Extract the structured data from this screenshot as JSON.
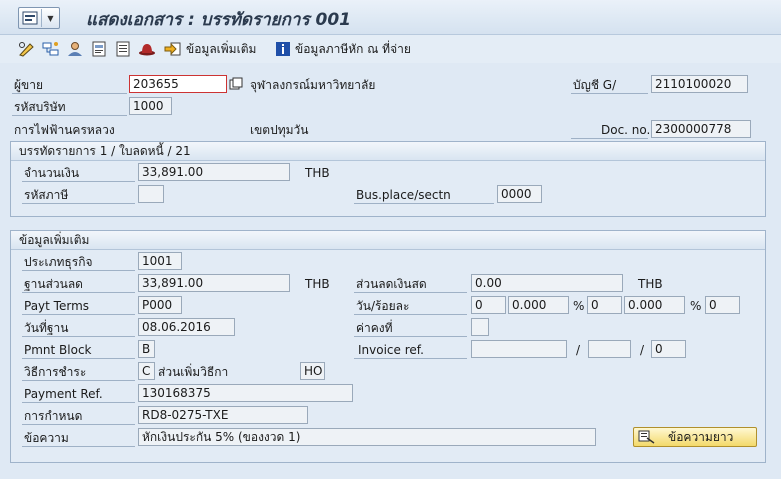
{
  "window": {
    "title": "แสดงเอกสาร : บรรทัดรายการ 001"
  },
  "toolbar": {
    "additional_data_label": "ข้อมูลเพิ่มเติม",
    "withholding_tax_label": "ข้อมูลภาษีหัก ณ ที่จ่าย"
  },
  "header": {
    "vendor_label": "ผู้ขาย",
    "vendor_value": "203655",
    "vendor_name": "จุฬาลงกรณ์มหาวิทยาลัย",
    "gl_account_label": "บัญชี G/",
    "gl_account_value": "2110100020",
    "company_code_label": "รหัสบริษัท",
    "company_code_value": "1000",
    "company_name": "การไฟฟ้านครหลวง",
    "city": "เขตปทุมวัน",
    "doc_no_label": "Doc. no.",
    "doc_no_value": "2300000778"
  },
  "line_item": {
    "title": "บรรทัดรายการ 1 / ใบลดหนี้ / 21",
    "amount_label": "จำนวนเงิน",
    "amount_value": "33,891.00",
    "currency": "THB",
    "tax_code_label": "รหัสภาษี",
    "tax_code_value": "",
    "bus_place_label": "Bus.place/sectn",
    "bus_place_value": "0000"
  },
  "additional": {
    "title": "ข้อมูลเพิ่มเติม",
    "business_type_label": "ประเภทธุรกิจ",
    "business_type_value": "1001",
    "discount_base_label": "ฐานส่วนลด",
    "discount_base_value": "33,891.00",
    "discount_base_currency": "THB",
    "cash_discount_label": "ส่วนลดเงินสด",
    "cash_discount_value": "0.00",
    "cash_discount_currency": "THB",
    "payt_terms_label": "Payt Terms",
    "payt_terms_value": "P000",
    "days_pct_label": "วัน/ร้อยละ",
    "days1": "0",
    "pct1": "0.000",
    "days2": "0",
    "pct2": "0.000",
    "days3": "0",
    "percent_symbol": "%",
    "baseline_date_label": "วันที่ฐาน",
    "baseline_date_value": "08.06.2016",
    "fixed_label": "ค่าคงที่",
    "fixed_value": "",
    "pmnt_block_label": "Pmnt Block",
    "pmnt_block_value": "B",
    "invoice_ref_label": "Invoice ref.",
    "invoice_ref_1": "",
    "invoice_ref_2": "",
    "invoice_ref_3": "0",
    "slash": "/",
    "pmt_method_label": "วิธีการชำระ",
    "pmt_method_value": "C",
    "pmt_method_supplement_label": "ส่วนเพิ่มวิธีกา",
    "pmt_method_supplement_value": "HO",
    "payment_ref_label": "Payment Ref.",
    "payment_ref_value": "130168375",
    "assignment_label": "การกำหนด",
    "assignment_value": "RD8-0275-TXE",
    "text_label": "ข้อความ",
    "text_value": "หักเงินประกัน 5% (ของงวด 1)",
    "long_text_button": "ข้อความยาว"
  },
  "colors": {
    "background": "#dfe9f4",
    "button_yellow": "#f3d96a",
    "required_border": "#cc3333"
  }
}
